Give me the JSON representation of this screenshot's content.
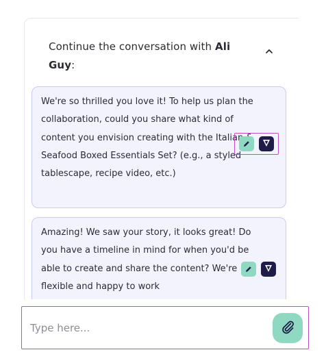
{
  "conversation": {
    "prompt_prefix": "Continue the conversation with ",
    "contact_name": "Ali Guy",
    "prompt_suffix": ":"
  },
  "suggestions": [
    {
      "text": "We're so thrilled you love it! To help us plan the collaboration, could you share what kind of content you envision creating with the Italian & Seafood Boxed Essentials Set? (e.g., a styled tablescape, recipe video, etc.)"
    },
    {
      "text": "Amazing! We saw your story, it looks great! Do you have a timeline in mind for when you'd be able to create and share the content? We're flexible and happy to work"
    }
  ],
  "composer": {
    "placeholder": "Type here..."
  },
  "icons": {
    "collapse": "chevron-up-icon",
    "edit": "pencil-icon",
    "send": "send-icon",
    "attach": "paperclip-icon"
  },
  "colors": {
    "accent_green": "#8fd9c2",
    "accent_navy": "#1e1d4a",
    "card_bg": "#f2f3fd",
    "card_border": "#c9cdf0",
    "highlight": "#c04fc2"
  }
}
